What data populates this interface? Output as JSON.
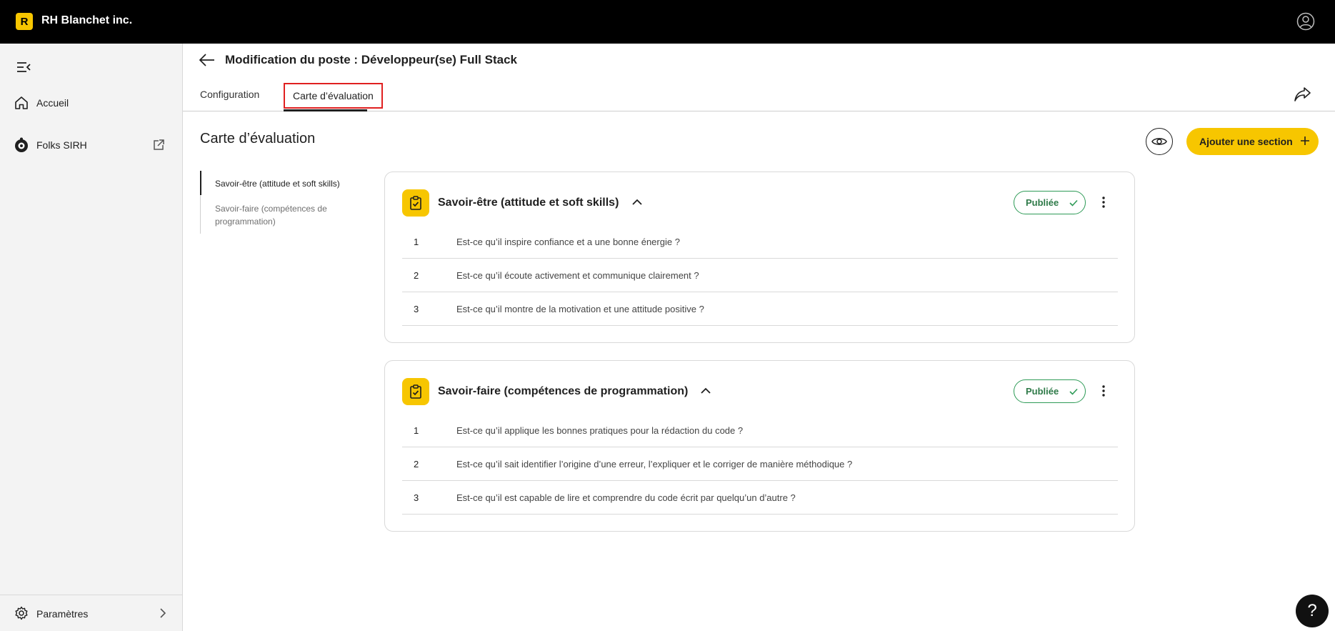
{
  "topbar": {
    "logo_letter": "R",
    "brand_name": "RH Blanchet inc."
  },
  "sidebar": {
    "items": [
      {
        "label": "Accueil",
        "icon": "home-icon"
      },
      {
        "label": "Folks SIRH",
        "icon": "folks-logo-icon"
      }
    ],
    "footer_label": "Paramètres"
  },
  "header": {
    "title": "Modification du poste : Développeur(se) Full Stack",
    "tabs": [
      {
        "label": "Configuration"
      },
      {
        "label": "Carte d’évaluation"
      }
    ]
  },
  "content": {
    "heading": "Carte d’évaluation",
    "add_section_label": "Ajouter une section",
    "section_nav": [
      "Savoir-être (attitude et soft skills)",
      "Savoir-faire (compétences de programmation)"
    ],
    "sections": [
      {
        "title": "Savoir-être (attitude et soft skills)",
        "status": "Publiée",
        "questions": [
          {
            "num": "1",
            "text": "Est-ce qu’il inspire confiance et a une bonne énergie ?"
          },
          {
            "num": "2",
            "text": "Est-ce qu’il écoute activement et communique clairement ?"
          },
          {
            "num": "3",
            "text": "Est-ce qu’il montre de la motivation et une attitude positive ?"
          }
        ]
      },
      {
        "title": "Savoir-faire (compétences de programmation)",
        "status": "Publiée",
        "questions": [
          {
            "num": "1",
            "text": "Est-ce qu’il applique les bonnes pratiques pour la rédaction du code ?"
          },
          {
            "num": "2",
            "text": "Est-ce qu’il sait identifier l’origine d’une erreur, l’expliquer et le corriger de manière méthodique ?"
          },
          {
            "num": "3",
            "text": "Est-ce qu’il est capable de lire et comprendre du code écrit par quelqu’un d’autre ?"
          }
        ]
      }
    ]
  },
  "help": {
    "label": "?"
  },
  "colors": {
    "accent": "#f7c600",
    "published": "#2e9b57",
    "highlight": "#e02020"
  }
}
